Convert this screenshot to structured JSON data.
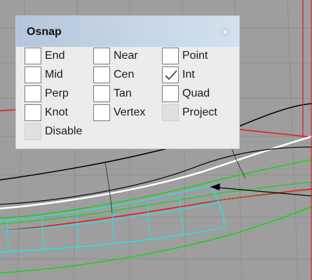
{
  "panel": {
    "title": "Osnap",
    "close_icon": "close-icon",
    "options": [
      {
        "id": "end",
        "label": "End",
        "checked": false,
        "enabled": true
      },
      {
        "id": "near",
        "label": "Near",
        "checked": false,
        "enabled": true
      },
      {
        "id": "point",
        "label": "Point",
        "checked": false,
        "enabled": true
      },
      {
        "id": "mid",
        "label": "Mid",
        "checked": false,
        "enabled": true
      },
      {
        "id": "cen",
        "label": "Cen",
        "checked": false,
        "enabled": true
      },
      {
        "id": "int",
        "label": "Int",
        "checked": true,
        "enabled": true
      },
      {
        "id": "perp",
        "label": "Perp",
        "checked": false,
        "enabled": true
      },
      {
        "id": "tan",
        "label": "Tan",
        "checked": false,
        "enabled": true
      },
      {
        "id": "quad",
        "label": "Quad",
        "checked": false,
        "enabled": true
      },
      {
        "id": "knot",
        "label": "Knot",
        "checked": false,
        "enabled": true
      },
      {
        "id": "vertex",
        "label": "Vertex",
        "checked": false,
        "enabled": true
      },
      {
        "id": "project",
        "label": "Project",
        "checked": false,
        "enabled": false
      },
      {
        "id": "disable",
        "label": "Disable",
        "checked": false,
        "enabled": false
      }
    ]
  },
  "viewport": {
    "background": "#9e9e9e",
    "colors": {
      "red": "#e8141e",
      "green": "#19d219",
      "cyan": "#22e6e6",
      "white": "#ffffff",
      "black": "#000000"
    }
  }
}
